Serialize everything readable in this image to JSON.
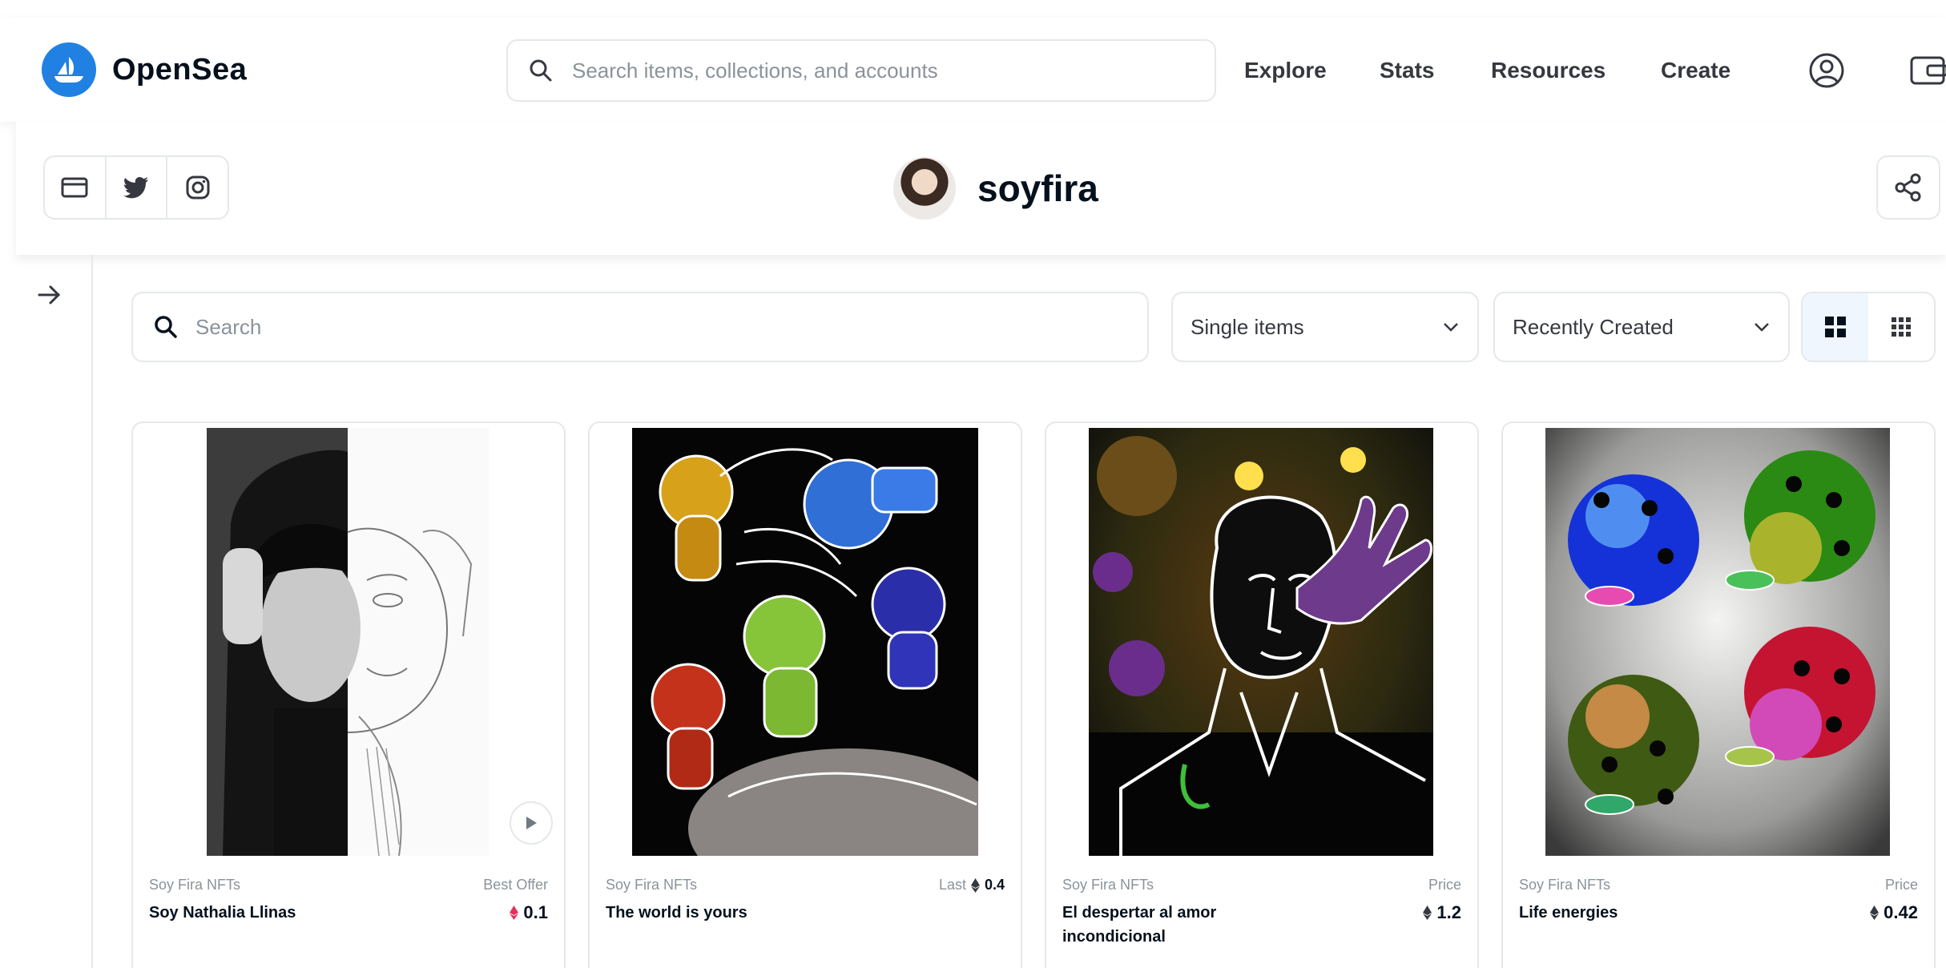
{
  "header": {
    "logo_text": "OpenSea",
    "search_placeholder": "Search items, collections, and accounts",
    "nav": [
      "Explore",
      "Stats",
      "Resources",
      "Create"
    ]
  },
  "profile": {
    "name": "soyfira"
  },
  "filters": {
    "search_placeholder": "Search",
    "type_selected": "Single items",
    "sort_selected": "Recently Created"
  },
  "cards": [
    {
      "collection": "Soy Fira NFTs",
      "title": "Soy Nathalia Llinas",
      "price_label": "Best Offer",
      "price": "0.1",
      "price_color": "#e2325b"
    },
    {
      "collection": "Soy Fira NFTs",
      "title": "The world is yours",
      "price_label": "Last",
      "price_label_value": "0.4",
      "price": ""
    },
    {
      "collection": "Soy Fira NFTs",
      "title": "El despertar al amor incondicional",
      "price_label": "Price",
      "price": "1.2"
    },
    {
      "collection": "Soy Fira NFTs",
      "title": "Life energies",
      "price_label": "Price",
      "price": "0.42"
    }
  ],
  "colors": {
    "brand": "#2081e2",
    "border": "#e5e8eb",
    "text": "#04111d",
    "muted": "#8a939b"
  }
}
